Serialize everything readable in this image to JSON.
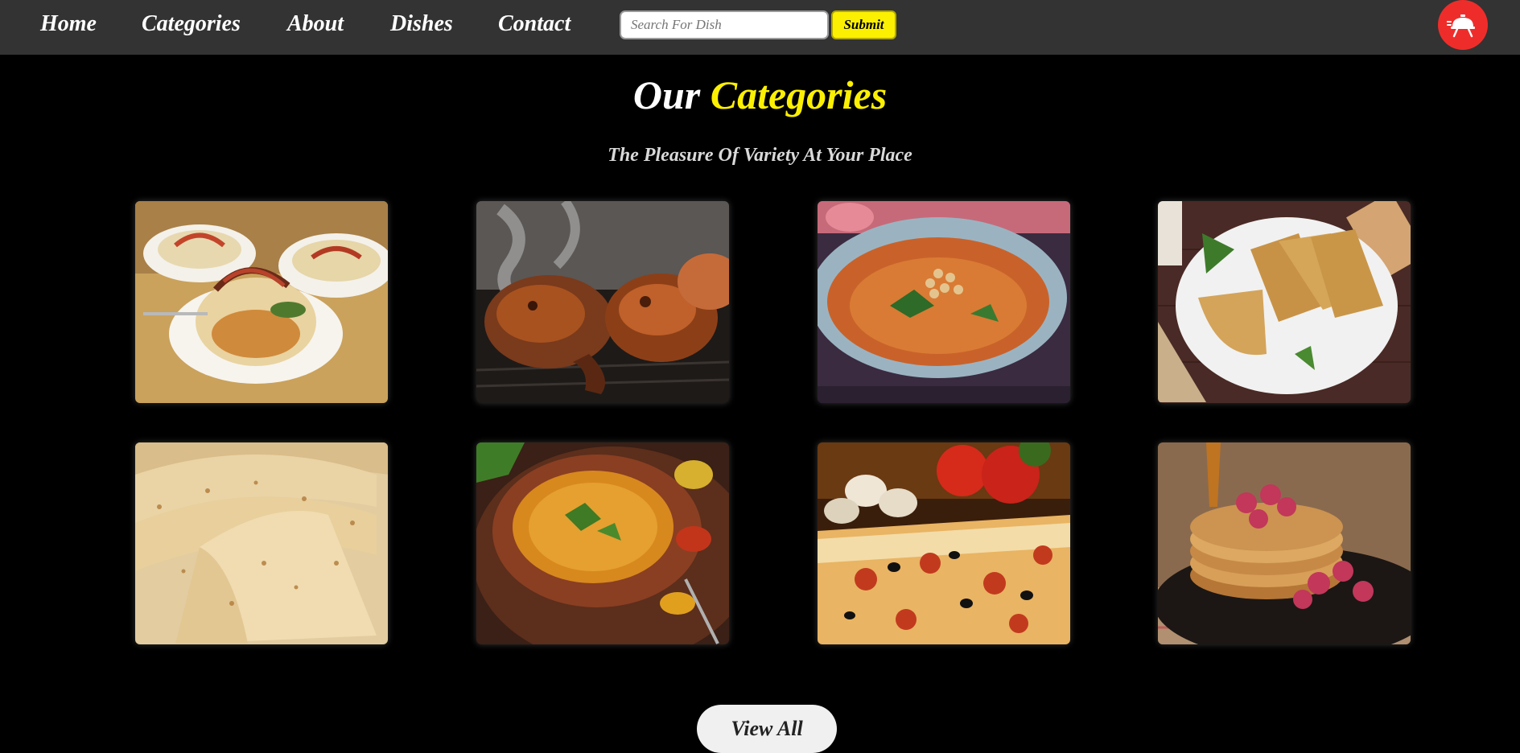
{
  "nav": {
    "links": [
      "Home",
      "Categories",
      "About",
      "Dishes",
      "Contact"
    ],
    "search_placeholder": "Search For Dish",
    "submit_label": "Submit",
    "logo_icon": "delivery-cloche-icon"
  },
  "section": {
    "title_prefix": "Our",
    "title_accent": "Categories",
    "subtitle": "The Pleasure Of Variety At Your Place",
    "view_all_label": "View All"
  },
  "categories": [
    {
      "image": "rice-bowls-with-fried-onions"
    },
    {
      "image": "grilled-chicken-legs"
    },
    {
      "image": "chickpea-curry-bowl"
    },
    {
      "image": "paratha-on-white-plate"
    },
    {
      "image": "stacked-roti-flatbreads"
    },
    {
      "image": "dal-in-clay-bowl"
    },
    {
      "image": "pizza-with-tomatoes-and-mushrooms"
    },
    {
      "image": "pancakes-with-raspberries"
    }
  ],
  "colors": {
    "nav_background": "#333333",
    "page_background": "#000000",
    "accent_yellow": "#fcf002",
    "logo_red": "#ee2d2a",
    "text_white": "#ffffff"
  }
}
